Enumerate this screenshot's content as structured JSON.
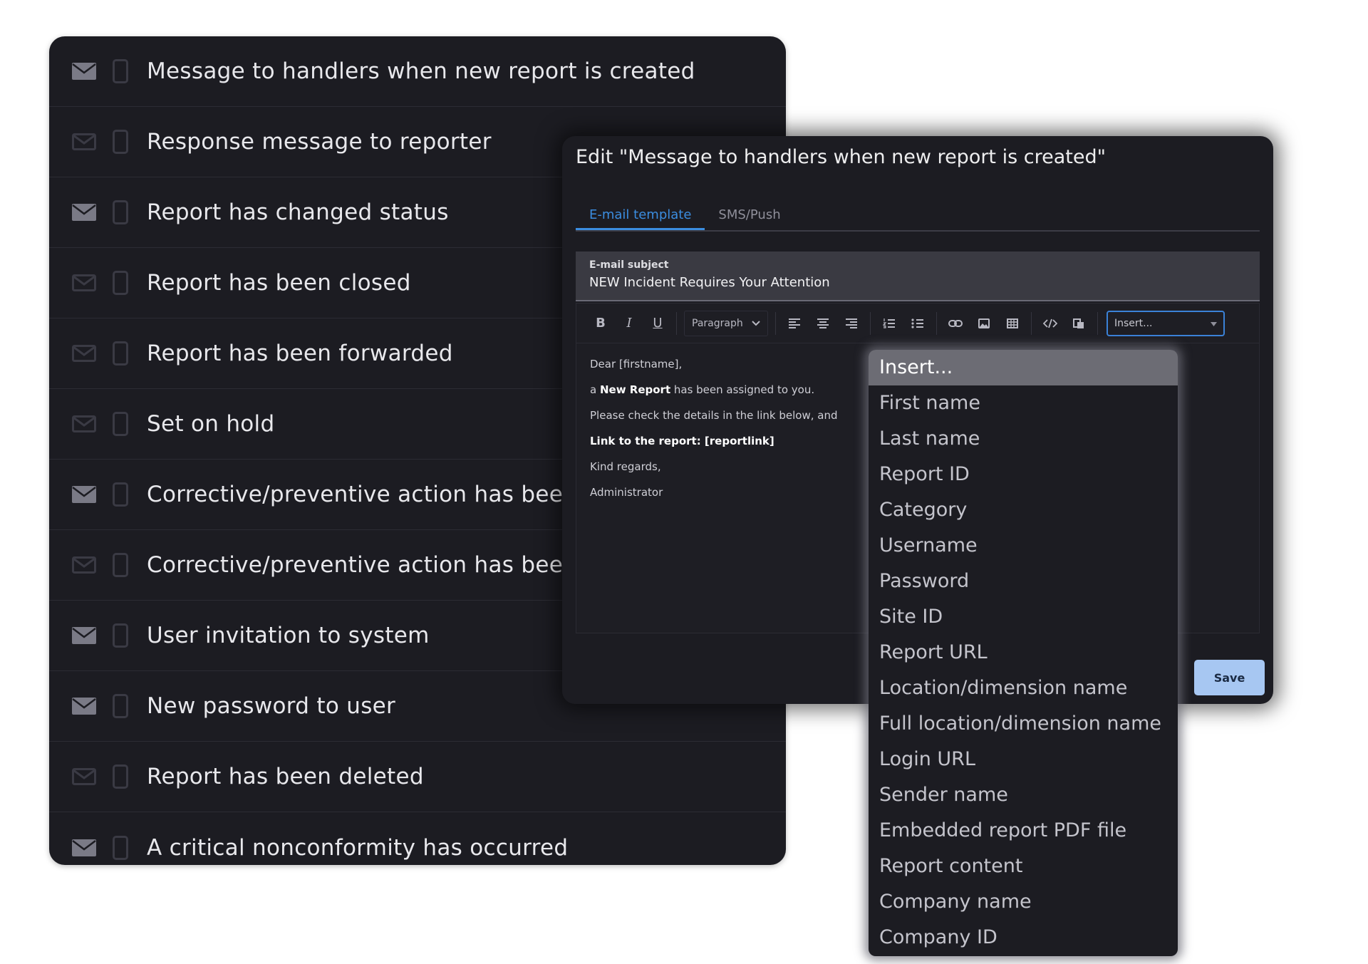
{
  "notifications": [
    {
      "label": "Message to handlers when new report is created",
      "email_enabled": true
    },
    {
      "label": "Response message to reporter",
      "email_enabled": false
    },
    {
      "label": "Report has changed status",
      "email_enabled": true
    },
    {
      "label": "Report has been closed",
      "email_enabled": false
    },
    {
      "label": "Report has been forwarded",
      "email_enabled": false
    },
    {
      "label": "Set on hold",
      "email_enabled": false
    },
    {
      "label": "Corrective/preventive action has bee",
      "email_enabled": true
    },
    {
      "label": "Corrective/preventive action has bee",
      "email_enabled": false
    },
    {
      "label": "User invitation to system",
      "email_enabled": true
    },
    {
      "label": "New password to user",
      "email_enabled": true
    },
    {
      "label": "Report has been deleted",
      "email_enabled": false
    },
    {
      "label": "A critical nonconformity has occurred",
      "email_enabled": true
    }
  ],
  "modal": {
    "title": "Edit \"Message to handlers when new report is created\"",
    "tabs": [
      "E-mail template",
      "SMS/Push"
    ],
    "active_tab": 0,
    "subject_label": "E-mail subject",
    "subject_value": "NEW Incident Requires Your Attention",
    "toolbar": {
      "bold": "B",
      "italic": "I",
      "underline": "U",
      "block_format": "Paragraph",
      "insert_placeholder": "Insert..."
    },
    "body": {
      "line1": "Dear [firstname],",
      "line2_prefix": "a ",
      "line2_bold": "New Report",
      "line2_suffix": " has been assigned to you.",
      "line3": "Please check the details in the link below, and",
      "line4": "Link to the report: [reportlink]",
      "line5": "Kind regards,",
      "line6": "Administrator"
    },
    "save_label": "Save"
  },
  "insert_dropdown": {
    "header": "Insert...",
    "items": [
      "First name",
      "Last name",
      "Report ID",
      "Category",
      "Username",
      "Password",
      "Site ID",
      "Report URL",
      "Location/dimension name",
      "Full location/dimension name",
      "Login URL",
      "Sender name",
      "Embedded report PDF file",
      "Report content",
      "Company name",
      "Company ID"
    ]
  },
  "colors": {
    "panel_bg": "#1c1c22",
    "accent": "#3b8de0",
    "save_bg": "#a7c7f2",
    "mail_on": "#7a7a86",
    "mail_off": "#3a3a44"
  }
}
